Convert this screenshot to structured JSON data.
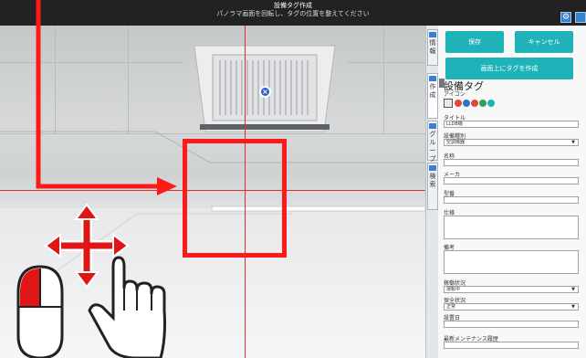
{
  "topbar": {
    "title": "設備タグ作成",
    "subtitle": "パノラマ画面を回転し、タグの位置を整えてください"
  },
  "icons": {
    "settings": "gear-icon",
    "panel_toggle": "panel-toggle-icon",
    "tag_marker": "close-icon",
    "move": "move-arrows-icon",
    "mouse": "mouse-icon",
    "hand": "hand-pointer-icon"
  },
  "tabs": [
    {
      "label": "情報"
    },
    {
      "label": "作成"
    },
    {
      "label": "グループ"
    },
    {
      "label": "検索"
    }
  ],
  "panel": {
    "save_label": "保存",
    "cancel_label": "キャンセル",
    "create_tag_label": "画面上にタグを作成",
    "heading": "設備タグ",
    "icon_label": "アイコン",
    "title_label": "タイトル",
    "title_value": "LLDB機",
    "equipment_type_label": "設備種別",
    "equipment_type_value": "空調機器",
    "name_label": "名称",
    "maker_label": "メーカ",
    "model_label": "型番",
    "spec_label": "仕様",
    "remarks_label": "備考",
    "operation_status_label": "稼働状況",
    "operation_status_value": "運転中",
    "maintenance_status_label": "保全状況",
    "maintenance_status_value": "正常",
    "install_date_label": "設置日",
    "last_maintenance_label": "最新メンテナンス履歴"
  },
  "colors": {
    "accent_teal": "#1fb2b9",
    "highlight_red": "#ff1a1a",
    "crosshair_red": "#e52b2b",
    "topbar": "#222222",
    "tag_blue": "#2a5bc9"
  }
}
